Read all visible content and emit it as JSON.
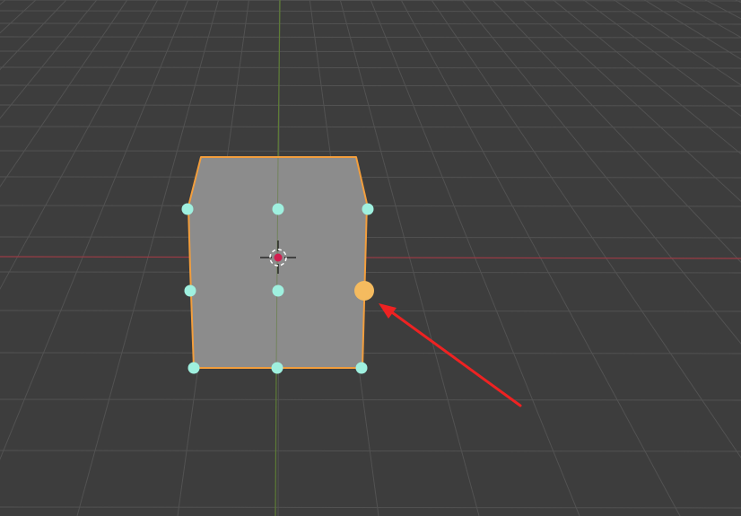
{
  "viewport": {
    "mode": "3d-viewport",
    "view": "perspective"
  },
  "colors": {
    "background": "#3d3d3d",
    "grid_line": "#525252",
    "x_axis": "#9b3b45",
    "y_axis": "#5e7d36",
    "mesh_fill": "#8c8c8c",
    "mesh_outline": "#f29e3d",
    "handle": "#9ff0df",
    "handle_active": "#f5bb5f",
    "cursor_red": "#d11e50",
    "cursor_ring": "#ffffff",
    "annotation_arrow": "#ee2222"
  },
  "object": {
    "type": "mesh",
    "state": "selected-active"
  },
  "handles": {
    "count": 9,
    "active_index": 5
  },
  "icons": [
    "3d-cursor-icon",
    "arrow-annotation"
  ]
}
